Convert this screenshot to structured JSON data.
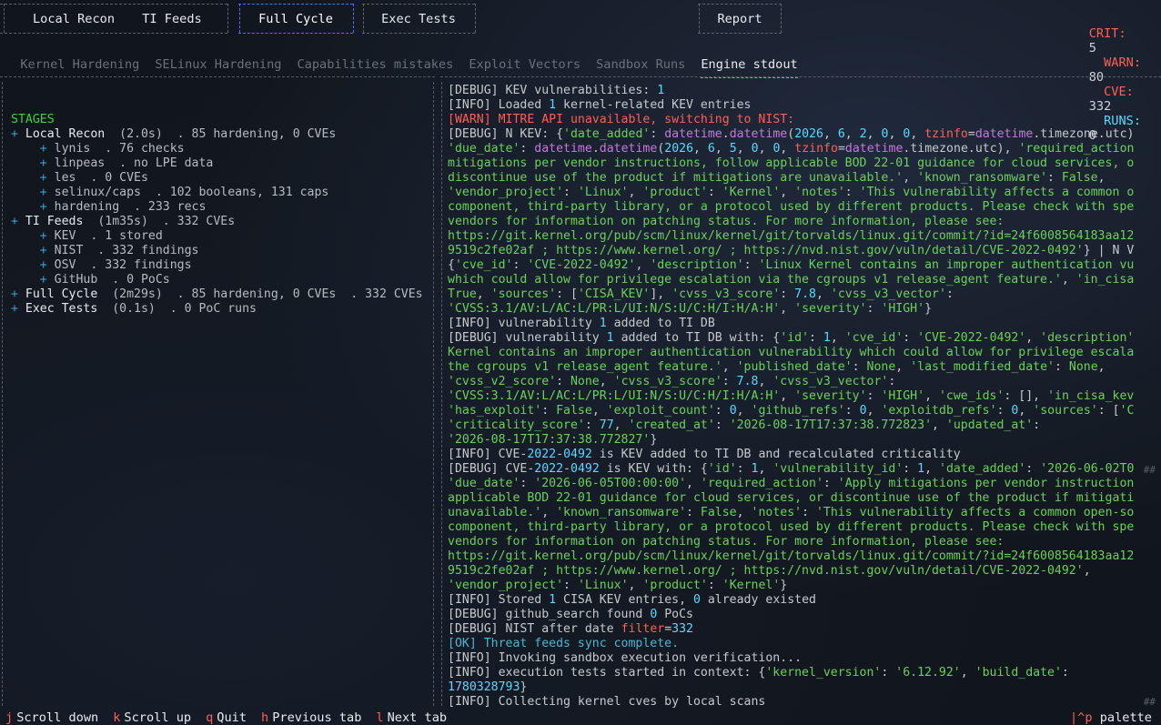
{
  "nav": {
    "buttons": [
      "Local Recon",
      "TI Feeds",
      "Full Cycle",
      "Exec Tests",
      "Report"
    ],
    "active": "Full Cycle"
  },
  "stats": {
    "crit_label": "CRIT:",
    "crit": "5",
    "warn_label": "WARN:",
    "warn": "80",
    "cve_label": "CVE:",
    "cve": "332",
    "runs_label": "RUNS:",
    "runs": "0"
  },
  "tabs": [
    "Kernel Hardening",
    "SELinux Hardening",
    "Capabilities mistakes",
    "Exploit Vectors",
    "Sandbox Runs",
    "Engine stdout"
  ],
  "active_tab": "Engine stdout",
  "stages": {
    "title": "STAGES",
    "items": [
      {
        "name": "Local Recon",
        "meta": "(2.0s)  . 85 hardening, 0 CVEs",
        "subs": [
          "lynis  . 76 checks",
          "linpeas  . no LPE data",
          "les  . 0 CVEs",
          "selinux/caps  . 102 booleans, 131 caps",
          "hardening  . 233 recs"
        ]
      },
      {
        "name": "TI Feeds",
        "meta": "(1m35s)  . 332 CVEs",
        "subs": [
          "KEV  . 1 stored",
          "NIST  . 332 findings",
          "OSV  . 332 findings",
          "GitHub  . 0 PoCs"
        ]
      },
      {
        "name": "Full Cycle",
        "meta": "(2m29s)  . 85 hardening, 0 CVEs  . 332 CVEs",
        "subs": []
      },
      {
        "name": "Exec Tests",
        "meta": "(0.1s)  . 0 PoC runs",
        "subs": []
      }
    ]
  },
  "log": [
    [
      [
        "d",
        "[DEBUG] KEV vulnerabilities: "
      ],
      [
        "n",
        "1"
      ]
    ],
    [
      [
        "d",
        "[INFO] Loaded "
      ],
      [
        "n",
        "1"
      ],
      [
        "d",
        " kernel-related KEV entries"
      ]
    ],
    [
      [
        "w",
        "[WARN] MITRE API unavailable, switching to NIST:"
      ]
    ],
    [
      [
        "d",
        "[DEBUG] N KEV: {"
      ],
      [
        "g",
        "'date_added'"
      ],
      [
        "d",
        ": "
      ],
      [
        "k",
        "datetime"
      ],
      [
        "d",
        "."
      ],
      [
        "k",
        "datetime"
      ],
      [
        "d",
        "("
      ],
      [
        "n",
        "2026"
      ],
      [
        "d",
        ", "
      ],
      [
        "n",
        "6"
      ],
      [
        "d",
        ", "
      ],
      [
        "n",
        "2"
      ],
      [
        "d",
        ", "
      ],
      [
        "n",
        "0"
      ],
      [
        "d",
        ", "
      ],
      [
        "n",
        "0"
      ],
      [
        "d",
        ", "
      ],
      [
        "b",
        "tzinfo"
      ],
      [
        "d",
        "="
      ],
      [
        "k",
        "datetime"
      ],
      [
        "d",
        ".timezone.utc)"
      ]
    ],
    [
      [
        "g",
        "'due_date'"
      ],
      [
        "d",
        ": "
      ],
      [
        "k",
        "datetime"
      ],
      [
        "d",
        "."
      ],
      [
        "k",
        "datetime"
      ],
      [
        "d",
        "("
      ],
      [
        "n",
        "2026"
      ],
      [
        "d",
        ", "
      ],
      [
        "n",
        "6"
      ],
      [
        "d",
        ", "
      ],
      [
        "n",
        "5"
      ],
      [
        "d",
        ", "
      ],
      [
        "n",
        "0"
      ],
      [
        "d",
        ", "
      ],
      [
        "n",
        "0"
      ],
      [
        "d",
        ", "
      ],
      [
        "b",
        "tzinfo"
      ],
      [
        "d",
        "="
      ],
      [
        "k",
        "datetime"
      ],
      [
        "d",
        ".timezone.utc), "
      ],
      [
        "g",
        "'required_action"
      ]
    ],
    [
      [
        "g",
        "mitigations per vendor instructions, follow applicable BOD 22-01 guidance for cloud services, o"
      ]
    ],
    [
      [
        "g",
        "discontinue use of the product if mitigations are unavailable.'"
      ],
      [
        "d",
        ", "
      ],
      [
        "g",
        "'known_ransomware'"
      ],
      [
        "d",
        ": "
      ],
      [
        "f",
        "False"
      ],
      [
        "d",
        ","
      ]
    ],
    [
      [
        "g",
        "'vendor_project'"
      ],
      [
        "d",
        ": "
      ],
      [
        "g",
        "'Linux'"
      ],
      [
        "d",
        ", "
      ],
      [
        "g",
        "'product'"
      ],
      [
        "d",
        ": "
      ],
      [
        "g",
        "'Kernel'"
      ],
      [
        "d",
        ", "
      ],
      [
        "g",
        "'notes'"
      ],
      [
        "d",
        ": "
      ],
      [
        "g",
        "'This vulnerability affects a common o"
      ]
    ],
    [
      [
        "g",
        "component, third-party library, or a protocol used by different products. Please check with spe"
      ]
    ],
    [
      [
        "g",
        "vendors for information on patching status. For more information, please see:"
      ]
    ],
    [
      [
        "g",
        "https://git.kernel.org/pub/scm/linux/kernel/git/torvalds/linux.git/commit/?id=24f6008564183aa12"
      ]
    ],
    [
      [
        "g",
        "9519c2fe02af ; https://www.kernel.org/ ; https://nvd.nist.gov/vuln/detail/CVE-2022-0492'"
      ],
      [
        "d",
        "} | N V"
      ]
    ],
    [
      [
        "d",
        "{"
      ],
      [
        "g",
        "'cve_id'"
      ],
      [
        "d",
        ": "
      ],
      [
        "g",
        "'CVE-2022-0492'"
      ],
      [
        "d",
        ", "
      ],
      [
        "g",
        "'description'"
      ],
      [
        "d",
        ": "
      ],
      [
        "g",
        "'Linux Kernel contains an improper authentication vu"
      ]
    ],
    [
      [
        "g",
        "which could allow for privilege escalation via the cgroups v1 release_agent feature.'"
      ],
      [
        "d",
        ", "
      ],
      [
        "g",
        "'in_cisa"
      ]
    ],
    [
      [
        "f",
        "True"
      ],
      [
        "d",
        ", "
      ],
      [
        "g",
        "'sources'"
      ],
      [
        "d",
        ": ["
      ],
      [
        "g",
        "'CISA_KEV'"
      ],
      [
        "d",
        "], "
      ],
      [
        "g",
        "'cvss_v3_score'"
      ],
      [
        "d",
        ": "
      ],
      [
        "n",
        "7.8"
      ],
      [
        "d",
        ", "
      ],
      [
        "g",
        "'cvss_v3_vector'"
      ],
      [
        "d",
        ":"
      ]
    ],
    [
      [
        "g",
        "'CVSS:3.1/AV:L/AC:L/PR:L/UI:N/S:U/C:H/I:H/A:H'"
      ],
      [
        "d",
        ", "
      ],
      [
        "g",
        "'severity'"
      ],
      [
        "d",
        ": "
      ],
      [
        "g",
        "'HIGH'"
      ],
      [
        "d",
        "}"
      ]
    ],
    [
      [
        "d",
        "[INFO] vulnerability "
      ],
      [
        "n",
        "1"
      ],
      [
        "d",
        " added to TI DB"
      ]
    ],
    [
      [
        "d",
        "[DEBUG] vulnerability "
      ],
      [
        "n",
        "1"
      ],
      [
        "d",
        " added to TI DB with: {"
      ],
      [
        "g",
        "'id'"
      ],
      [
        "d",
        ": "
      ],
      [
        "n",
        "1"
      ],
      [
        "d",
        ", "
      ],
      [
        "g",
        "'cve_id'"
      ],
      [
        "d",
        ": "
      ],
      [
        "g",
        "'CVE-2022-0492'"
      ],
      [
        "d",
        ", "
      ],
      [
        "g",
        "'description'"
      ]
    ],
    [
      [
        "g",
        "Kernel contains an improper authentication vulnerability which could allow for privilege escala"
      ]
    ],
    [
      [
        "g",
        "the cgroups v1 release_agent feature.'"
      ],
      [
        "d",
        ", "
      ],
      [
        "g",
        "'published_date'"
      ],
      [
        "d",
        ": "
      ],
      [
        "f",
        "None"
      ],
      [
        "d",
        ", "
      ],
      [
        "g",
        "'last_modified_date'"
      ],
      [
        "d",
        ": "
      ],
      [
        "f",
        "None"
      ],
      [
        "d",
        ","
      ]
    ],
    [
      [
        "g",
        "'cvss_v2_score'"
      ],
      [
        "d",
        ": "
      ],
      [
        "f",
        "None"
      ],
      [
        "d",
        ", "
      ],
      [
        "g",
        "'cvss_v3_score'"
      ],
      [
        "d",
        ": "
      ],
      [
        "n",
        "7.8"
      ],
      [
        "d",
        ", "
      ],
      [
        "g",
        "'cvss_v3_vector'"
      ],
      [
        "d",
        ":"
      ]
    ],
    [
      [
        "g",
        "'CVSS:3.1/AV:L/AC:L/PR:L/UI:N/S:U/C:H/I:H/A:H'"
      ],
      [
        "d",
        ", "
      ],
      [
        "g",
        "'severity'"
      ],
      [
        "d",
        ": "
      ],
      [
        "g",
        "'HIGH'"
      ],
      [
        "d",
        ", "
      ],
      [
        "g",
        "'cwe_ids'"
      ],
      [
        "d",
        ": [], "
      ],
      [
        "g",
        "'in_cisa_kev"
      ]
    ],
    [
      [
        "g",
        "'has_exploit'"
      ],
      [
        "d",
        ": "
      ],
      [
        "f",
        "False"
      ],
      [
        "d",
        ", "
      ],
      [
        "g",
        "'exploit_count'"
      ],
      [
        "d",
        ": "
      ],
      [
        "n",
        "0"
      ],
      [
        "d",
        ", "
      ],
      [
        "g",
        "'github_refs'"
      ],
      [
        "d",
        ": "
      ],
      [
        "n",
        "0"
      ],
      [
        "d",
        ", "
      ],
      [
        "g",
        "'exploitdb_refs'"
      ],
      [
        "d",
        ": "
      ],
      [
        "n",
        "0"
      ],
      [
        "d",
        ", "
      ],
      [
        "g",
        "'sources'"
      ],
      [
        "d",
        ": ["
      ],
      [
        "g",
        "'C"
      ]
    ],
    [
      [
        "g",
        "'criticality_score'"
      ],
      [
        "d",
        ": "
      ],
      [
        "n",
        "77"
      ],
      [
        "d",
        ", "
      ],
      [
        "g",
        "'created_at'"
      ],
      [
        "d",
        ": "
      ],
      [
        "g",
        "'2026-08-17T17:37:38.772823'"
      ],
      [
        "d",
        ", "
      ],
      [
        "g",
        "'updated_at'"
      ],
      [
        "d",
        ":"
      ]
    ],
    [
      [
        "g",
        "'2026-08-17T17:37:38.772827'"
      ],
      [
        "d",
        "}"
      ]
    ],
    [
      [
        "d",
        "[INFO] CVE-"
      ],
      [
        "n",
        "2022"
      ],
      [
        "d",
        "-"
      ],
      [
        "n",
        "0492"
      ],
      [
        "d",
        " is KEV added to TI DB and recalculated criticality"
      ]
    ],
    [
      [
        "d",
        "[DEBUG] CVE-"
      ],
      [
        "n",
        "2022"
      ],
      [
        "d",
        "-"
      ],
      [
        "n",
        "0492"
      ],
      [
        "d",
        " is KEV with: {"
      ],
      [
        "g",
        "'id'"
      ],
      [
        "d",
        ": "
      ],
      [
        "n",
        "1"
      ],
      [
        "d",
        ", "
      ],
      [
        "g",
        "'vulnerability_id'"
      ],
      [
        "d",
        ": "
      ],
      [
        "n",
        "1"
      ],
      [
        "d",
        ", "
      ],
      [
        "g",
        "'date_added'"
      ],
      [
        "d",
        ": "
      ],
      [
        "g",
        "'2026-06-02T0"
      ]
    ],
    [
      [
        "g",
        "'due_date'"
      ],
      [
        "d",
        ": "
      ],
      [
        "g",
        "'2026-06-05T00:00:00'"
      ],
      [
        "d",
        ", "
      ],
      [
        "g",
        "'required_action'"
      ],
      [
        "d",
        ": "
      ],
      [
        "g",
        "'Apply mitigations per vendor instruction"
      ]
    ],
    [
      [
        "g",
        "applicable BOD 22-01 guidance for cloud services, or discontinue use of the product if mitigati"
      ]
    ],
    [
      [
        "g",
        "unavailable.'"
      ],
      [
        "d",
        ", "
      ],
      [
        "g",
        "'known_ransomware'"
      ],
      [
        "d",
        ": "
      ],
      [
        "f",
        "False"
      ],
      [
        "d",
        ", "
      ],
      [
        "g",
        "'notes'"
      ],
      [
        "d",
        ": "
      ],
      [
        "g",
        "'This vulnerability affects a common open-so"
      ]
    ],
    [
      [
        "g",
        "component, third-party library, or a protocol used by different products. Please check with spe"
      ]
    ],
    [
      [
        "g",
        "vendors for information on patching status. For more information, please see:"
      ]
    ],
    [
      [
        "g",
        "https://git.kernel.org/pub/scm/linux/kernel/git/torvalds/linux.git/commit/?id=24f6008564183aa12"
      ]
    ],
    [
      [
        "g",
        "9519c2fe02af ; https://www.kernel.org/ ; https://nvd.nist.gov/vuln/detail/CVE-2022-0492'"
      ],
      [
        "d",
        ","
      ]
    ],
    [
      [
        "g",
        "'vendor_project'"
      ],
      [
        "d",
        ": "
      ],
      [
        "g",
        "'Linux'"
      ],
      [
        "d",
        ", "
      ],
      [
        "g",
        "'product'"
      ],
      [
        "d",
        ": "
      ],
      [
        "g",
        "'Kernel'"
      ],
      [
        "d",
        "}"
      ]
    ],
    [
      [
        "d",
        "[INFO] Stored "
      ],
      [
        "n",
        "1"
      ],
      [
        "d",
        " CISA KEV entries, "
      ],
      [
        "n",
        "0"
      ],
      [
        "d",
        " already existed"
      ]
    ],
    [
      [
        "d",
        "[DEBUG] github_search found "
      ],
      [
        "n",
        "0"
      ],
      [
        "d",
        " PoCs"
      ]
    ],
    [
      [
        "d",
        "[DEBUG] NIST after date "
      ],
      [
        "b",
        "filter"
      ],
      [
        "d",
        "="
      ],
      [
        "n",
        "332"
      ]
    ],
    [
      [
        "c",
        "[OK] Threat feeds sync complete."
      ]
    ],
    [
      [
        "d",
        "[INFO] Invoking sandbox execution verification..."
      ]
    ],
    [
      [
        "d",
        "[INFO] execution tests started in context: {"
      ],
      [
        "g",
        "'kernel_version'"
      ],
      [
        "d",
        ": "
      ],
      [
        "g",
        "'6.12.92'"
      ],
      [
        "d",
        ", "
      ],
      [
        "g",
        "'build_date'"
      ],
      [
        "d",
        ":"
      ]
    ],
    [
      [
        "n",
        "1780328793"
      ],
      [
        "d",
        "}"
      ]
    ],
    [
      [
        "d",
        "[INFO] Collecting kernel cves by local scans"
      ]
    ]
  ],
  "footer": [
    {
      "key": "j",
      "label": "Scroll down"
    },
    {
      "key": "k",
      "label": "Scroll up"
    },
    {
      "key": "q",
      "label": "Quit"
    },
    {
      "key": "h",
      "label": "Previous tab"
    },
    {
      "key": "l",
      "label": "Next tab"
    }
  ],
  "palette": {
    "key": "^p",
    "label": "palette"
  }
}
